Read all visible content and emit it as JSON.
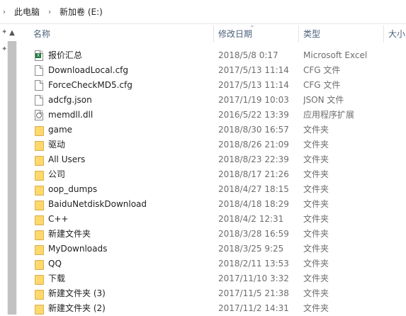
{
  "breadcrumb": {
    "items": [
      "此电脑",
      "新加卷 (E:)"
    ]
  },
  "columns": {
    "name": "名称",
    "date": "修改日期",
    "type": "类型",
    "size": "大小"
  },
  "files": [
    {
      "name": "报价汇总",
      "date": "2018/5/8 0:17",
      "type": "Microsoft Excel",
      "icon": "excel-file-icon"
    },
    {
      "name": "DownloadLocal.cfg",
      "date": "2017/5/13 11:14",
      "type": "CFG 文件",
      "icon": "file-icon"
    },
    {
      "name": "ForceCheckMD5.cfg",
      "date": "2017/5/13 11:14",
      "type": "CFG 文件",
      "icon": "file-icon"
    },
    {
      "name": "adcfg.json",
      "date": "2017/1/19 10:03",
      "type": "JSON 文件",
      "icon": "file-icon"
    },
    {
      "name": "memdll.dll",
      "date": "2016/5/22 13:39",
      "type": "应用程序扩展",
      "icon": "dll-file-icon"
    },
    {
      "name": "game",
      "date": "2018/8/30 16:57",
      "type": "文件夹",
      "icon": "folder-icon"
    },
    {
      "name": "驱动",
      "date": "2018/8/26 21:09",
      "type": "文件夹",
      "icon": "folder-icon"
    },
    {
      "name": "All Users",
      "date": "2018/8/23 22:39",
      "type": "文件夹",
      "icon": "folder-icon"
    },
    {
      "name": "公司",
      "date": "2018/8/17 21:26",
      "type": "文件夹",
      "icon": "folder-icon"
    },
    {
      "name": "oop_dumps",
      "date": "2018/4/27 18:15",
      "type": "文件夹",
      "icon": "folder-icon"
    },
    {
      "name": "BaiduNetdiskDownload",
      "date": "2018/4/18 18:29",
      "type": "文件夹",
      "icon": "folder-icon"
    },
    {
      "name": "C++",
      "date": "2018/4/2 12:31",
      "type": "文件夹",
      "icon": "folder-icon"
    },
    {
      "name": "新建文件夹",
      "date": "2018/3/28 16:59",
      "type": "文件夹",
      "icon": "folder-icon"
    },
    {
      "name": "MyDownloads",
      "date": "2018/3/25 9:25",
      "type": "文件夹",
      "icon": "folder-icon"
    },
    {
      "name": "QQ",
      "date": "2018/2/11 13:53",
      "type": "文件夹",
      "icon": "folder-icon"
    },
    {
      "name": "下载",
      "date": "2017/11/10 3:32",
      "type": "文件夹",
      "icon": "folder-icon"
    },
    {
      "name": "新建文件夹 (3)",
      "date": "2017/11/5 21:38",
      "type": "文件夹",
      "icon": "folder-icon"
    },
    {
      "name": "新建文件夹 (2)",
      "date": "2017/11/2 14:31",
      "type": "文件夹",
      "icon": "folder-icon"
    }
  ]
}
